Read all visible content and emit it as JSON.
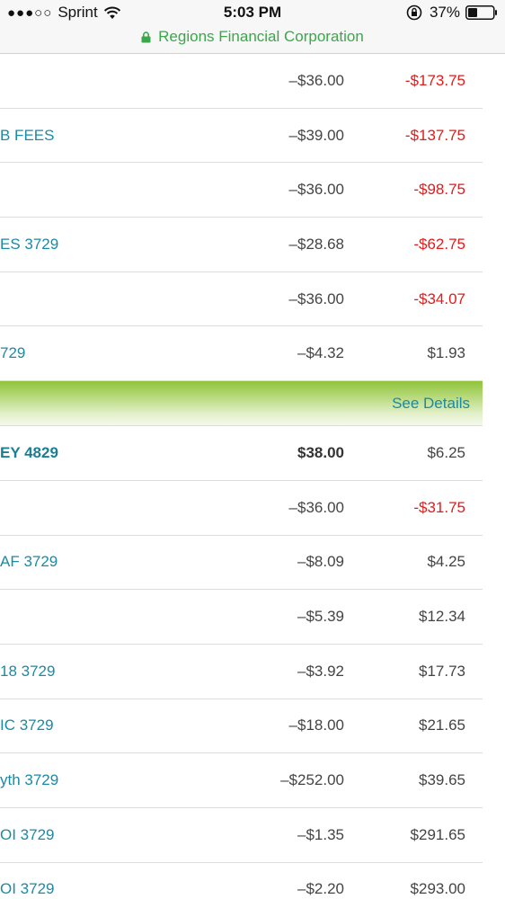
{
  "status_bar": {
    "signal": "●●●○○",
    "carrier": "Sprint",
    "time": "5:03 PM",
    "battery_percent": "37%",
    "battery_level": 0.37,
    "domain": "Regions Financial Corporation"
  },
  "see_details_label": "See Details",
  "rows_before": [
    {
      "desc": "",
      "amount": "–$36.00",
      "balance": "-$173.75",
      "negative": true
    },
    {
      "desc": "B FEES",
      "amount": "–$39.00",
      "balance": "-$137.75",
      "negative": true
    },
    {
      "desc": "",
      "amount": "–$36.00",
      "balance": "-$98.75",
      "negative": true
    },
    {
      "desc": "ES 3729",
      "amount": "–$28.68",
      "balance": "-$62.75",
      "negative": true
    },
    {
      "desc": "",
      "amount": "–$36.00",
      "balance": "-$34.07",
      "negative": true
    },
    {
      "desc": "729",
      "amount": "–$4.32",
      "balance": "$1.93",
      "negative": false
    }
  ],
  "rows_after": [
    {
      "desc": "EY 4829",
      "amount": "$38.00",
      "balance": "$6.25",
      "negative": false
    },
    {
      "desc": "",
      "amount": "–$36.00",
      "balance": "-$31.75",
      "negative": true
    },
    {
      "desc": "AF 3729",
      "amount": "–$8.09",
      "balance": "$4.25",
      "negative": false
    },
    {
      "desc": "",
      "amount": "–$5.39",
      "balance": "$12.34",
      "negative": false
    },
    {
      "desc": "18 3729",
      "amount": "–$3.92",
      "balance": "$17.73",
      "negative": false
    },
    {
      "desc": "IC 3729",
      "amount": "–$18.00",
      "balance": "$21.65",
      "negative": false
    },
    {
      "desc": "yth 3729",
      "amount": "–$252.00",
      "balance": "$39.65",
      "negative": false
    },
    {
      "desc": "OI 3729",
      "amount": "–$1.35",
      "balance": "$291.65",
      "negative": false
    },
    {
      "desc": "OI 3729",
      "amount": "–$2.20",
      "balance": "$293.00",
      "negative": false
    }
  ],
  "colors": {
    "link": "#1b8aa5",
    "negative": "#e21b1b",
    "secure": "#3aa84a",
    "banner": "#8fc43c"
  }
}
